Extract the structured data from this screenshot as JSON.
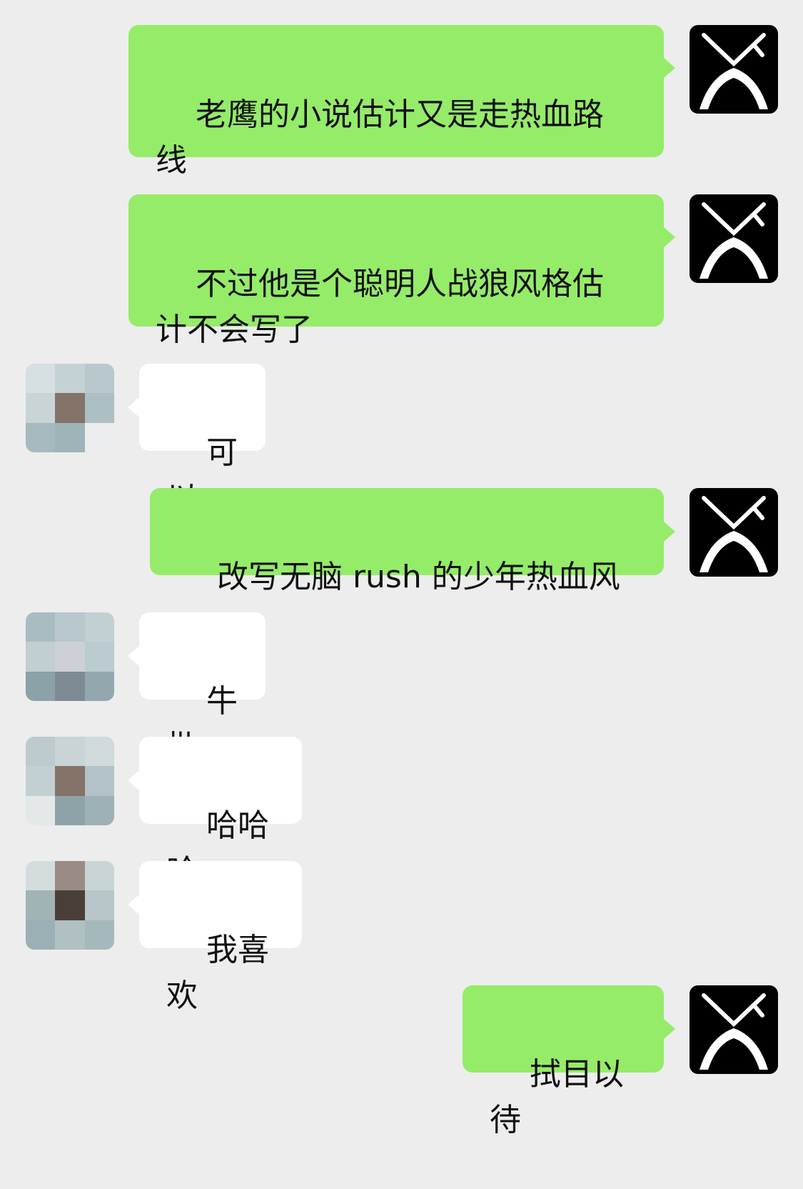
{
  "messages": [
    {
      "side": "mine",
      "text": "老鹰的小说估计又是走热血路\n线"
    },
    {
      "side": "mine",
      "text": "不过他是个聪明人战狼风格估\n计不会写了"
    },
    {
      "side": "theirs",
      "text": "可以"
    },
    {
      "side": "mine",
      "text": "改写无脑 rush 的少年热血风"
    },
    {
      "side": "theirs",
      "text": "牛批"
    },
    {
      "side": "theirs",
      "text": "哈哈哈"
    },
    {
      "side": "theirs",
      "text": "我喜欢"
    },
    {
      "side": "mine",
      "text": "拭目以待"
    }
  ],
  "colors": {
    "background": "#ededed",
    "mine_bubble": "#95ec69",
    "theirs_bubble": "#ffffff",
    "text": "#111111",
    "own_avatar_bg": "#000000"
  },
  "icons": {
    "own_avatar": "stylized-x-logo-icon",
    "other_avatar": "pixelated-avatar-icon"
  }
}
